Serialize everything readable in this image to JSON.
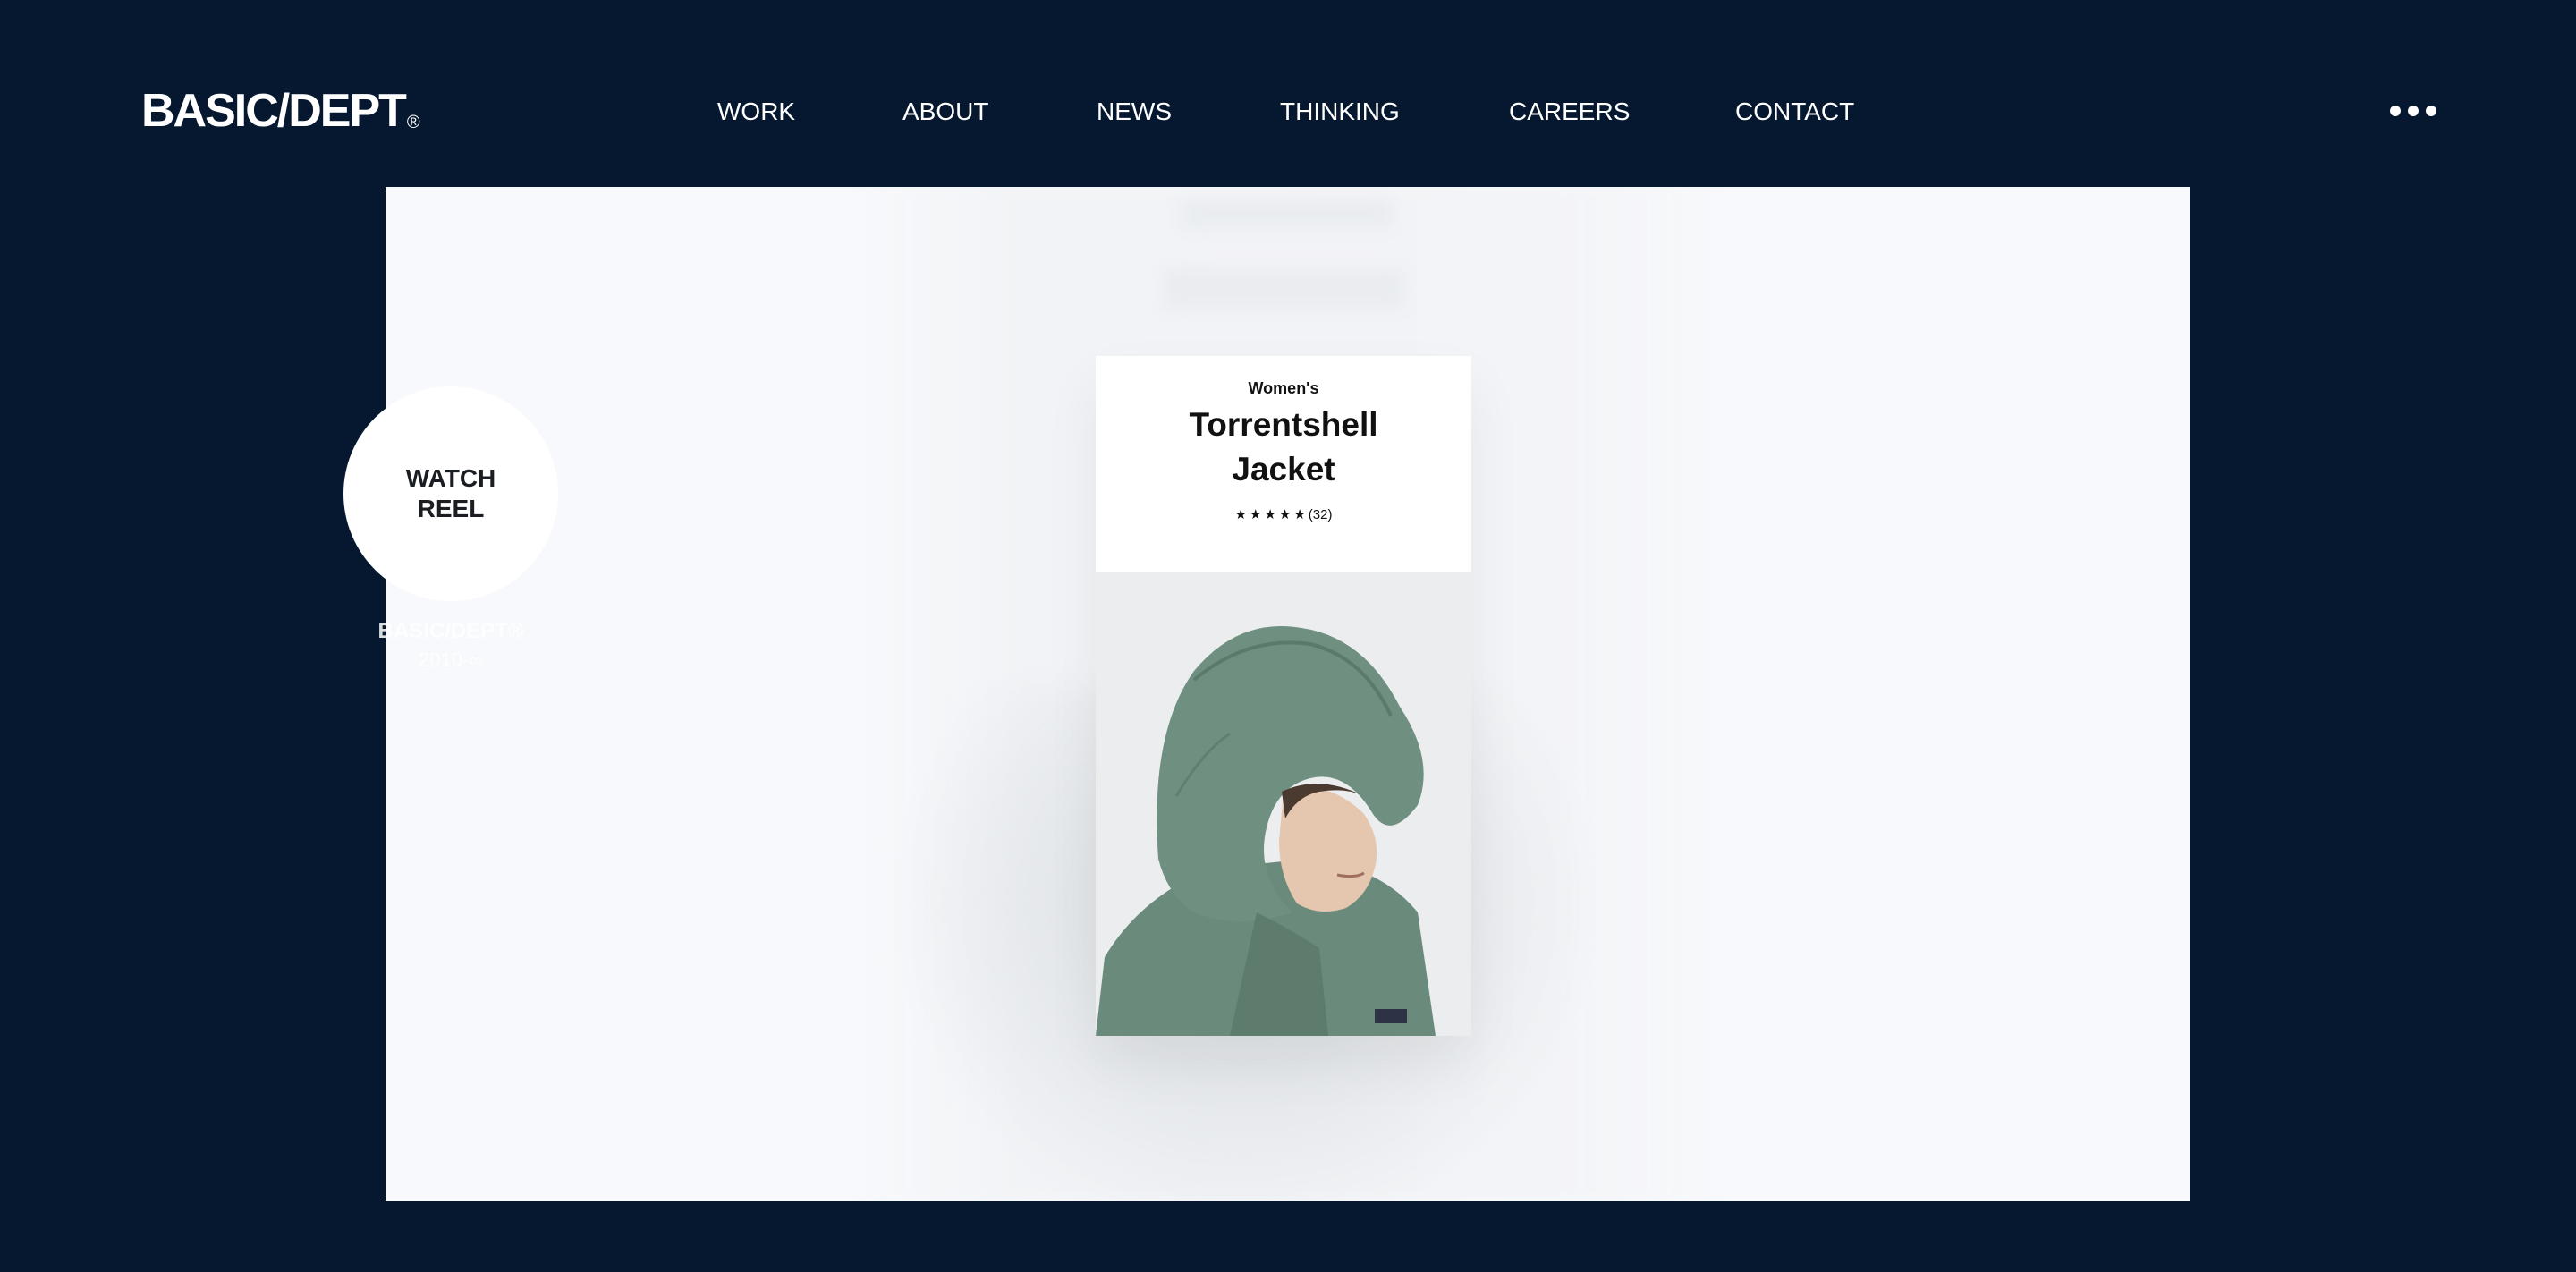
{
  "header": {
    "logo_text": "BASIC/DEPT",
    "logo_mark": "®",
    "nav": [
      {
        "label": "WORK"
      },
      {
        "label": "ABOUT"
      },
      {
        "label": "NEWS"
      },
      {
        "label": "THINKING"
      },
      {
        "label": "CAREERS"
      },
      {
        "label": "CONTACT"
      }
    ],
    "more_icon": "ellipsis-horizontal"
  },
  "hero": {
    "product": {
      "category": "Women's",
      "title_line1": "Torrentshell",
      "title_line2": "Jacket",
      "stars": "★★★★★",
      "review_count": "(32)",
      "jacket_color": "#6b8c7c"
    }
  },
  "reel": {
    "label_line1": "WATCH",
    "label_line2": "REEL",
    "caption_line1": "BASIC/DEPT®",
    "caption_line2": "2010-∞"
  },
  "colors": {
    "background": "#061730",
    "text_on_dark": "#ffffff",
    "hero_bg": "#f8f9fc"
  }
}
